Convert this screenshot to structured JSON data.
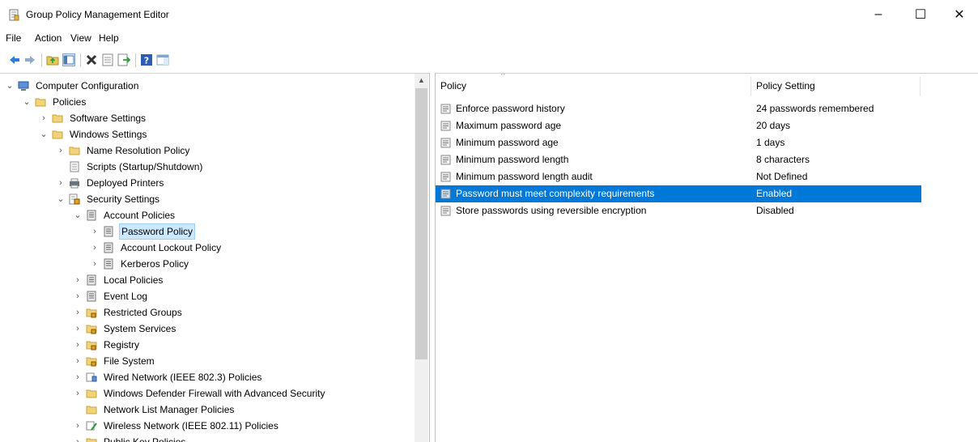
{
  "window": {
    "title": "Group Policy Management Editor",
    "minimize": "–",
    "maximize": "☐",
    "close": "✕"
  },
  "menu": [
    "File",
    "Action",
    "View",
    "Help"
  ],
  "toolbar_icons": [
    "back-arrow",
    "forward-arrow",
    "up-folder",
    "show-hide-tree",
    "delete",
    "properties",
    "export-list",
    "help",
    "show-action-pane"
  ],
  "tree": [
    {
      "label": "Computer Configuration",
      "level": 0,
      "arrow": "expanded",
      "icon": "computer"
    },
    {
      "label": "Policies",
      "level": 1,
      "arrow": "expanded",
      "icon": "folder"
    },
    {
      "label": "Software Settings",
      "level": 2,
      "arrow": "collapsed",
      "icon": "folder"
    },
    {
      "label": "Windows Settings",
      "level": 2,
      "arrow": "expanded",
      "icon": "folder"
    },
    {
      "label": "Name Resolution Policy",
      "level": 3,
      "arrow": "collapsed",
      "icon": "folder"
    },
    {
      "label": "Scripts (Startup/Shutdown)",
      "level": 3,
      "arrow": "none",
      "icon": "script"
    },
    {
      "label": "Deployed Printers",
      "level": 3,
      "arrow": "collapsed",
      "icon": "printer"
    },
    {
      "label": "Security Settings",
      "level": 3,
      "arrow": "expanded",
      "icon": "security"
    },
    {
      "label": "Account Policies",
      "level": 4,
      "arrow": "expanded",
      "icon": "policy"
    },
    {
      "label": "Password Policy",
      "level": 5,
      "arrow": "collapsed",
      "icon": "policy",
      "selected": true
    },
    {
      "label": "Account Lockout Policy",
      "level": 5,
      "arrow": "collapsed",
      "icon": "policy"
    },
    {
      "label": "Kerberos Policy",
      "level": 5,
      "arrow": "collapsed",
      "icon": "policy"
    },
    {
      "label": "Local Policies",
      "level": 4,
      "arrow": "collapsed",
      "icon": "policy"
    },
    {
      "label": "Event Log",
      "level": 4,
      "arrow": "collapsed",
      "icon": "policy"
    },
    {
      "label": "Restricted Groups",
      "level": 4,
      "arrow": "collapsed",
      "icon": "lock-folder"
    },
    {
      "label": "System Services",
      "level": 4,
      "arrow": "collapsed",
      "icon": "lock-folder"
    },
    {
      "label": "Registry",
      "level": 4,
      "arrow": "collapsed",
      "icon": "lock-folder"
    },
    {
      "label": "File System",
      "level": 4,
      "arrow": "collapsed",
      "icon": "lock-folder"
    },
    {
      "label": "Wired Network (IEEE 802.3) Policies",
      "level": 4,
      "arrow": "collapsed",
      "icon": "network"
    },
    {
      "label": "Windows Defender Firewall with Advanced Security",
      "level": 4,
      "arrow": "collapsed",
      "icon": "folder"
    },
    {
      "label": "Network List Manager Policies",
      "level": 4,
      "arrow": "none",
      "icon": "folder"
    },
    {
      "label": "Wireless Network (IEEE 802.11) Policies",
      "level": 4,
      "arrow": "collapsed",
      "icon": "wireless"
    },
    {
      "label": "Public Key Policies",
      "level": 4,
      "arrow": "collapsed",
      "icon": "folder"
    }
  ],
  "list": {
    "columns": [
      "Policy",
      "Policy Setting"
    ],
    "rows": [
      {
        "policy": "Enforce password history",
        "setting": "24 passwords remembered"
      },
      {
        "policy": "Maximum password age",
        "setting": "20 days"
      },
      {
        "policy": "Minimum password age",
        "setting": "1 days"
      },
      {
        "policy": "Minimum password length",
        "setting": "8 characters"
      },
      {
        "policy": "Minimum password length audit",
        "setting": "Not Defined"
      },
      {
        "policy": "Password must meet complexity requirements",
        "setting": "Enabled",
        "selected": true
      },
      {
        "policy": "Store passwords using reversible encryption",
        "setting": "Disabled"
      }
    ]
  },
  "colors": {
    "selection": "#0078d7",
    "tree_selection": "#cce8ff",
    "folder": "#e8c65a"
  }
}
